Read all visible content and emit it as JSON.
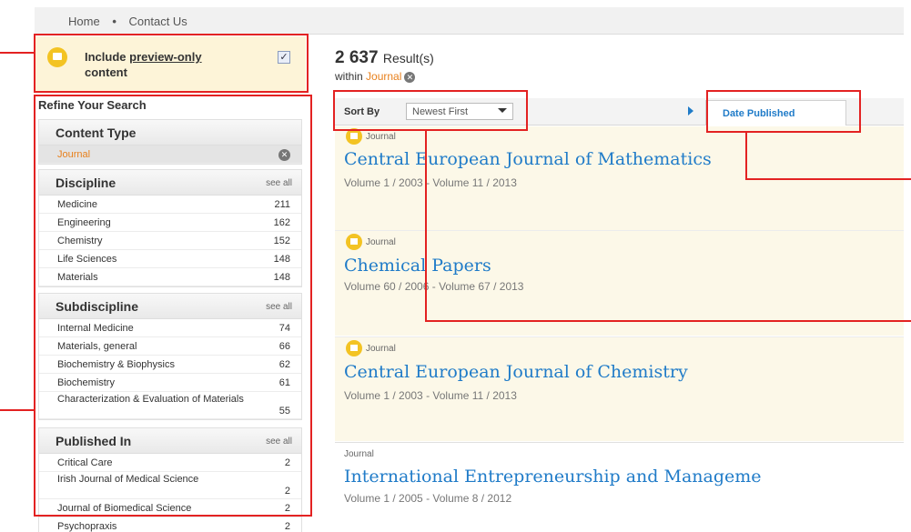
{
  "nav": {
    "home": "Home",
    "sep": "•",
    "contact": "Contact Us"
  },
  "preview": {
    "label_pre": "Include ",
    "label_link": "preview-only",
    "label_post": " content",
    "checked": "✓"
  },
  "refine": {
    "title": "Refine Your Search"
  },
  "content_type": {
    "title": "Content Type",
    "selected": "Journal"
  },
  "discipline": {
    "title": "Discipline",
    "see_all": "see all",
    "items": [
      {
        "label": "Medicine",
        "count": "211"
      },
      {
        "label": "Engineering",
        "count": "162"
      },
      {
        "label": "Chemistry",
        "count": "152"
      },
      {
        "label": "Life Sciences",
        "count": "148"
      },
      {
        "label": "Materials",
        "count": "148"
      }
    ]
  },
  "subdiscipline": {
    "title": "Subdiscipline",
    "see_all": "see all",
    "items": [
      {
        "label": "Internal Medicine",
        "count": "74"
      },
      {
        "label": "Materials, general",
        "count": "66"
      },
      {
        "label": "Biochemistry & Biophysics",
        "count": "62"
      },
      {
        "label": "Biochemistry",
        "count": "61"
      },
      {
        "label": "Characterization & Evaluation of Materials",
        "count": "55"
      }
    ]
  },
  "published_in": {
    "title": "Published In",
    "see_all": "see all",
    "items": [
      {
        "label": "Critical Care",
        "count": "2"
      },
      {
        "label": "Irish Journal of Medical Science",
        "count": "2"
      },
      {
        "label": "Journal of Biomedical Science",
        "count": "2"
      },
      {
        "label": "Psychopraxis",
        "count": "2"
      }
    ]
  },
  "results": {
    "count": "2 637",
    "count_suffix": "Result(s)",
    "within": "within",
    "within_filter": "Journal"
  },
  "sort": {
    "label": "Sort By",
    "selected": "Newest First",
    "date_published": "Date Published"
  },
  "items": [
    {
      "tag": "Journal",
      "title": "Central European Journal of Mathematics",
      "volumes": "Volume 1 / 2003 - Volume 11 / 2013"
    },
    {
      "tag": "Journal",
      "title": "Chemical Papers",
      "volumes": "Volume 60 / 2006 - Volume 67 / 2013"
    },
    {
      "tag": "Journal",
      "title": "Central European Journal of Chemistry",
      "volumes": "Volume 1 / 2003 - Volume 11 / 2013"
    },
    {
      "tag": "Journal",
      "title": "International Entrepreneurship and Manageme",
      "volumes": "Volume 1 / 2005 - Volume 8 / 2012"
    }
  ],
  "colors": {
    "accent": "#1f7bc8",
    "orange": "#e8801c",
    "annotation": "#e32222",
    "lock": "#f3c323"
  }
}
